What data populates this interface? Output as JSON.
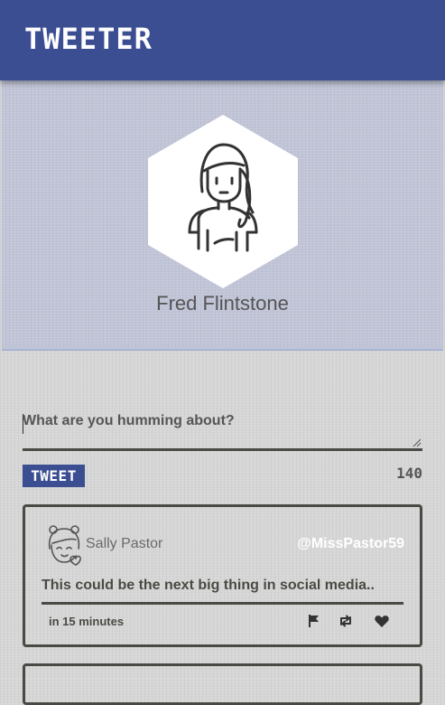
{
  "app": {
    "brand": "TWEETER"
  },
  "profile": {
    "name": "Fred Flintstone",
    "avatar_icon": "woman-avatar-icon"
  },
  "composer": {
    "placeholder": "What are you humming about?",
    "value": "",
    "submit_label": "TWEET",
    "char_count": "140"
  },
  "tweets": [
    {
      "name": "Sally Pastor",
      "handle": "@MissPastor59",
      "text": "This could be the next big thing in social media..",
      "time": "in 15 minutes",
      "avatar_icon": "girl-avatar-icon",
      "actions": [
        "flag-icon",
        "retweet-icon",
        "heart-icon"
      ]
    }
  ],
  "colors": {
    "brand": "#3c4e92",
    "card_border": "#4a4a44",
    "handle": "#ffffff"
  }
}
